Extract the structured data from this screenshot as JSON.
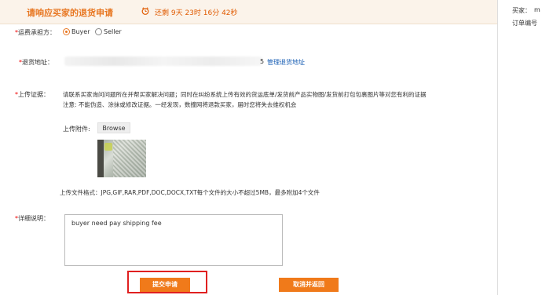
{
  "header": {
    "title": "请响应买家的退货申请",
    "countdown": "还剩 9天 23时 16分 42秒"
  },
  "side_panel": {
    "buyer_label": "买家：",
    "buyer_value": "m",
    "order_label": "订单编号"
  },
  "shipping_payer": {
    "label": "运费承担方：",
    "options": [
      "Buyer",
      "Seller"
    ],
    "selected": "Buyer"
  },
  "return_address": {
    "label": "退货地址：",
    "visible_fragment": "5",
    "manage_link": "管理退货地址"
  },
  "evidence": {
    "label": "上传证据：",
    "instruction_line1": "请联系买家询问问题所在并帮买家解决问题；同时在纠纷系统上传有效的货运底单/发货前产品实物图/发货前打包包裹图片等对您有利的证据",
    "instruction_line2": "注意: 不能伪造、涂抹或修改证据。一经发现，数撞网将退款买家，届时您将失去维权机会",
    "attachment_label": "上传附件:",
    "browse_label": "Browse",
    "file_format_note": "上传文件格式：JPG,GIF,RAR,PDF,DOC,DOCX,TXT每个文件的大小不超过5MB，最多附加4个文件"
  },
  "details": {
    "label": "详细说明：",
    "value": "buyer need pay shipping fee"
  },
  "actions": {
    "submit_label": "提交申请",
    "cancel_label": "取消并返回"
  },
  "colors": {
    "accent": "#f07a1a",
    "title": "#e87722",
    "countdown": "#e05a00",
    "link": "#1a5fb4",
    "required": "#e00000",
    "highlight": "#e02020"
  }
}
